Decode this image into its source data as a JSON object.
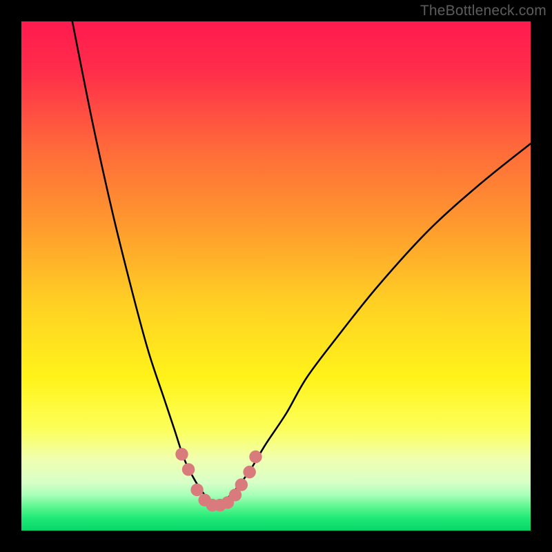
{
  "watermark": "TheBottleneck.com",
  "colors": {
    "frame_bg": "#000000",
    "curve_stroke": "#000000",
    "marker_fill": "#d97b7c",
    "gradient_stops": [
      {
        "offset": 0.0,
        "color": "#ff1a4f"
      },
      {
        "offset": 0.1,
        "color": "#ff2e4a"
      },
      {
        "offset": 0.25,
        "color": "#ff6a3a"
      },
      {
        "offset": 0.4,
        "color": "#ff9a2e"
      },
      {
        "offset": 0.55,
        "color": "#ffcf24"
      },
      {
        "offset": 0.7,
        "color": "#fff31a"
      },
      {
        "offset": 0.8,
        "color": "#fcff5a"
      },
      {
        "offset": 0.86,
        "color": "#f0ffb0"
      },
      {
        "offset": 0.905,
        "color": "#d8ffc8"
      },
      {
        "offset": 0.93,
        "color": "#a8ffb8"
      },
      {
        "offset": 0.955,
        "color": "#58f58e"
      },
      {
        "offset": 0.975,
        "color": "#20e977"
      },
      {
        "offset": 1.0,
        "color": "#07d668"
      }
    ]
  },
  "chart_data": {
    "type": "line",
    "title": "",
    "xlabel": "",
    "ylabel": "",
    "xlim": [
      0,
      100
    ],
    "ylim": [
      0,
      100
    ],
    "note": "V-shaped bottleneck curve; y is inverted (0 at top, 100 at bottom). Minimum near x≈38.",
    "series": [
      {
        "name": "bottleneck-curve",
        "x": [
          10,
          14,
          18,
          22,
          25,
          28,
          30,
          32,
          34,
          36,
          38,
          40,
          42,
          45,
          48,
          52,
          56,
          62,
          70,
          80,
          90,
          100
        ],
        "y": [
          0,
          20,
          38,
          54,
          65,
          74,
          80,
          86,
          90,
          93,
          95,
          94,
          92,
          88,
          83,
          77,
          70,
          62,
          52,
          41,
          32,
          24
        ]
      }
    ],
    "markers": {
      "name": "dip-markers",
      "x": [
        31.5,
        32.8,
        34.5,
        36,
        37.5,
        39,
        40.5,
        42,
        43.2,
        44.8,
        46
      ],
      "y": [
        85,
        88,
        92,
        94,
        95,
        95,
        94.5,
        93,
        91,
        88.5,
        85.5
      ]
    }
  }
}
